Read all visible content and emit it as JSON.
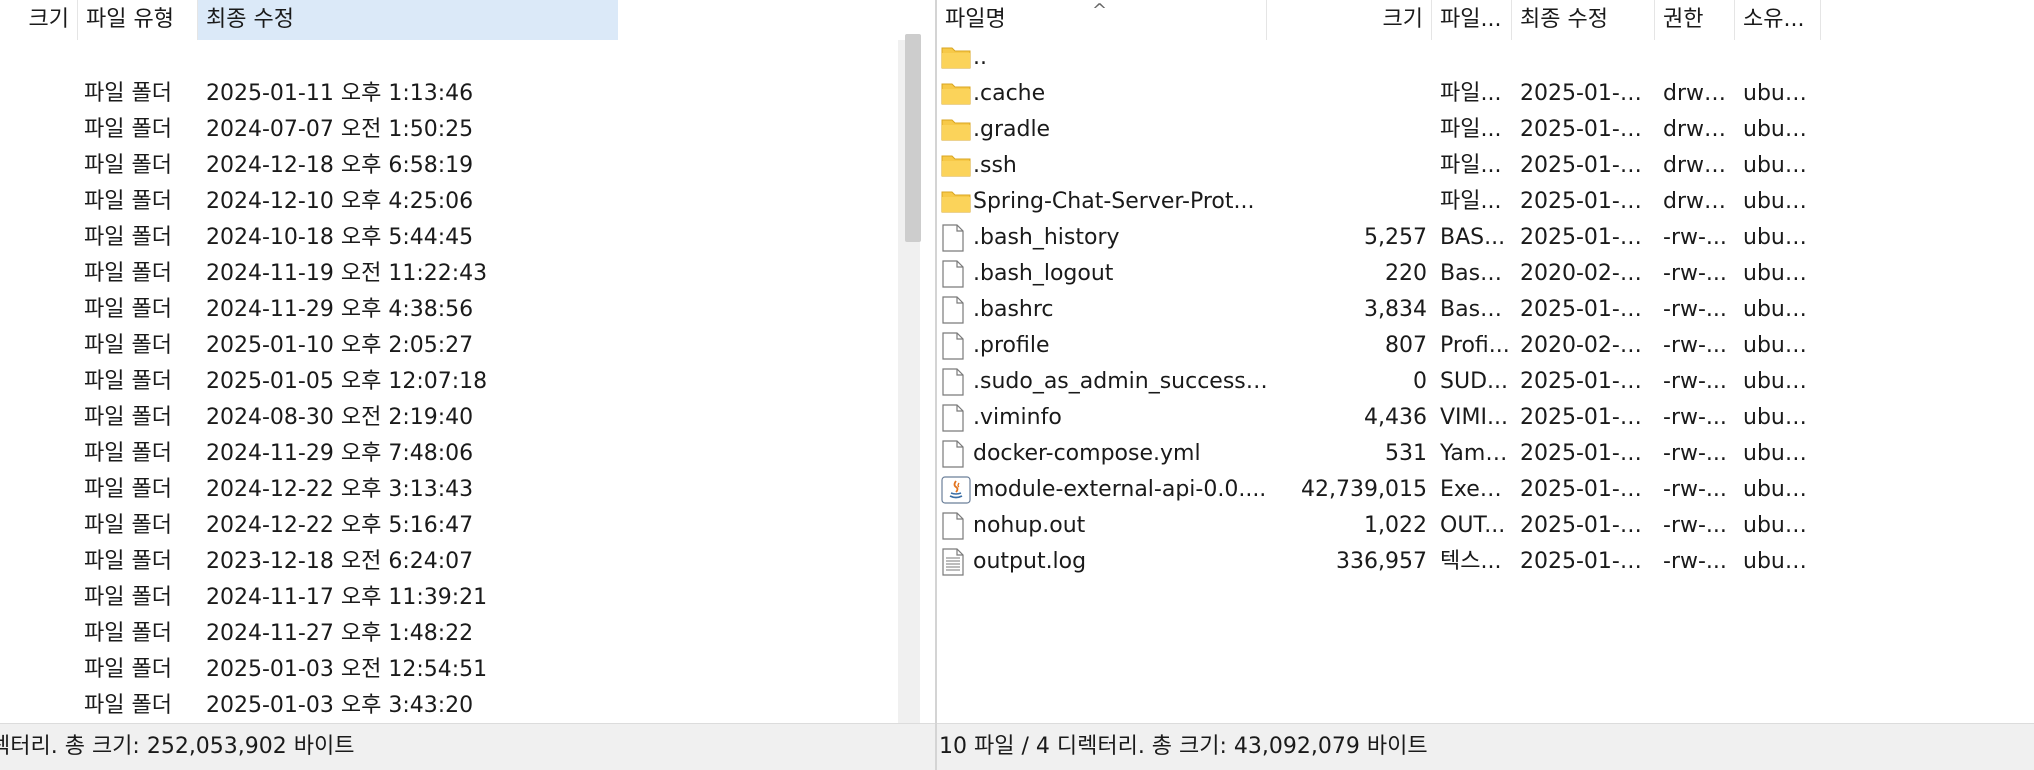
{
  "left": {
    "columns": {
      "size": "크기",
      "type": "파일 유형",
      "modified": "최종 수정"
    },
    "rows": [
      {
        "type": "",
        "modified": ""
      },
      {
        "type": "파일 폴더",
        "modified": "2025-01-11 오후 1:13:46"
      },
      {
        "type": "파일 폴더",
        "modified": "2024-07-07 오전 1:50:25"
      },
      {
        "type": "파일 폴더",
        "modified": "2024-12-18 오후 6:58:19"
      },
      {
        "type": "파일 폴더",
        "modified": "2024-12-10 오후 4:25:06"
      },
      {
        "type": "파일 폴더",
        "modified": "2024-10-18 오후 5:44:45"
      },
      {
        "type": "파일 폴더",
        "modified": "2024-11-19 오전 11:22:43"
      },
      {
        "type": "파일 폴더",
        "modified": "2024-11-29 오후 4:38:56"
      },
      {
        "type": "파일 폴더",
        "modified": "2025-01-10 오후 2:05:27"
      },
      {
        "type": "파일 폴더",
        "modified": "2025-01-05 오후 12:07:18"
      },
      {
        "type": "파일 폴더",
        "modified": "2024-08-30 오전 2:19:40"
      },
      {
        "type": "파일 폴더",
        "modified": "2024-11-29 오후 7:48:06"
      },
      {
        "type": "파일 폴더",
        "modified": "2024-12-22 오후 3:13:43"
      },
      {
        "type": "파일 폴더",
        "modified": "2024-12-22 오후 5:16:47"
      },
      {
        "type": "파일 폴더",
        "modified": "2023-12-18 오전 6:24:07"
      },
      {
        "type": "파일 폴더",
        "modified": "2024-11-17 오후 11:39:21"
      },
      {
        "type": "파일 폴더",
        "modified": "2024-11-27 오후 1:48:22"
      },
      {
        "type": "파일 폴더",
        "modified": "2025-01-03 오전 12:54:51"
      },
      {
        "type": "파일 폴더",
        "modified": "2025-01-03 오후 3:43:20"
      }
    ],
    "status": "렉터리. 총 크기: 252,053,902 바이트"
  },
  "right": {
    "columns": {
      "name": "파일명",
      "size": "크기",
      "type": "파일...",
      "modified": "최종 수정",
      "perm": "권한",
      "owner": "소유..."
    },
    "sort_arrow": "^",
    "rows": [
      {
        "icon": "folder-icon",
        "name": "..",
        "size": "",
        "type": "",
        "modified": "",
        "perm": "",
        "owner": ""
      },
      {
        "icon": "folder-icon",
        "name": ".cache",
        "size": "",
        "type": "파일...",
        "modified": "2025-01-0...",
        "perm": "drwx...",
        "owner": "ubun..."
      },
      {
        "icon": "folder-icon",
        "name": ".gradle",
        "size": "",
        "type": "파일...",
        "modified": "2025-01-0...",
        "perm": "drwx...",
        "owner": "ubun..."
      },
      {
        "icon": "folder-icon",
        "name": ".ssh",
        "size": "",
        "type": "파일...",
        "modified": "2025-01-0...",
        "perm": "drwx...",
        "owner": "ubun..."
      },
      {
        "icon": "folder-icon",
        "name": "Spring-Chat-Server-Prot...",
        "size": "",
        "type": "파일...",
        "modified": "2025-01-0...",
        "perm": "drwx...",
        "owner": "ubun..."
      },
      {
        "icon": "file-icon",
        "name": ".bash_history",
        "size": "5,257",
        "type": "BAS...",
        "modified": "2025-01-1...",
        "perm": "-rw-...",
        "owner": "ubun..."
      },
      {
        "icon": "file-icon",
        "name": ".bash_logout",
        "size": "220",
        "type": "Bash...",
        "modified": "2020-02-2...",
        "perm": "-rw-...",
        "owner": "ubun..."
      },
      {
        "icon": "file-icon",
        "name": ".bashrc",
        "size": "3,834",
        "type": "Bash...",
        "modified": "2025-01-0...",
        "perm": "-rw-...",
        "owner": "ubun..."
      },
      {
        "icon": "file-icon",
        "name": ".profile",
        "size": "807",
        "type": "Profi...",
        "modified": "2020-02-2...",
        "perm": "-rw-...",
        "owner": "ubun..."
      },
      {
        "icon": "file-icon",
        "name": ".sudo_as_admin_successful",
        "size": "0",
        "type": "SUD...",
        "modified": "2025-01-0...",
        "perm": "-rw-...",
        "owner": "ubun..."
      },
      {
        "icon": "file-icon",
        "name": ".viminfo",
        "size": "4,436",
        "type": "VIMI...",
        "modified": "2025-01-0...",
        "perm": "-rw-...",
        "owner": "ubun..."
      },
      {
        "icon": "file-icon",
        "name": "docker-compose.yml",
        "size": "531",
        "type": "Yaml...",
        "modified": "2025-01-0...",
        "perm": "-rw-...",
        "owner": "ubun..."
      },
      {
        "icon": "java-icon",
        "name": "module-external-api-0.0....",
        "size": "42,739,015",
        "type": "Exec...",
        "modified": "2025-01-1...",
        "perm": "-rw-...",
        "owner": "ubun..."
      },
      {
        "icon": "file-icon",
        "name": "nohup.out",
        "size": "1,022",
        "type": "OUT...",
        "modified": "2025-01-1...",
        "perm": "-rw-...",
        "owner": "ubun..."
      },
      {
        "icon": "text-file-icon",
        "name": "output.log",
        "size": "336,957",
        "type": "텍스...",
        "modified": "2025-01-1...",
        "perm": "-rw-...",
        "owner": "ubun..."
      }
    ],
    "status": "10 파일 / 4 디렉터리. 총 크기: 43,092,079 바이트"
  },
  "colors": {
    "header_active": "#dbe9f8",
    "folder": "#f7c948",
    "status_bg": "#f0f0f0"
  }
}
